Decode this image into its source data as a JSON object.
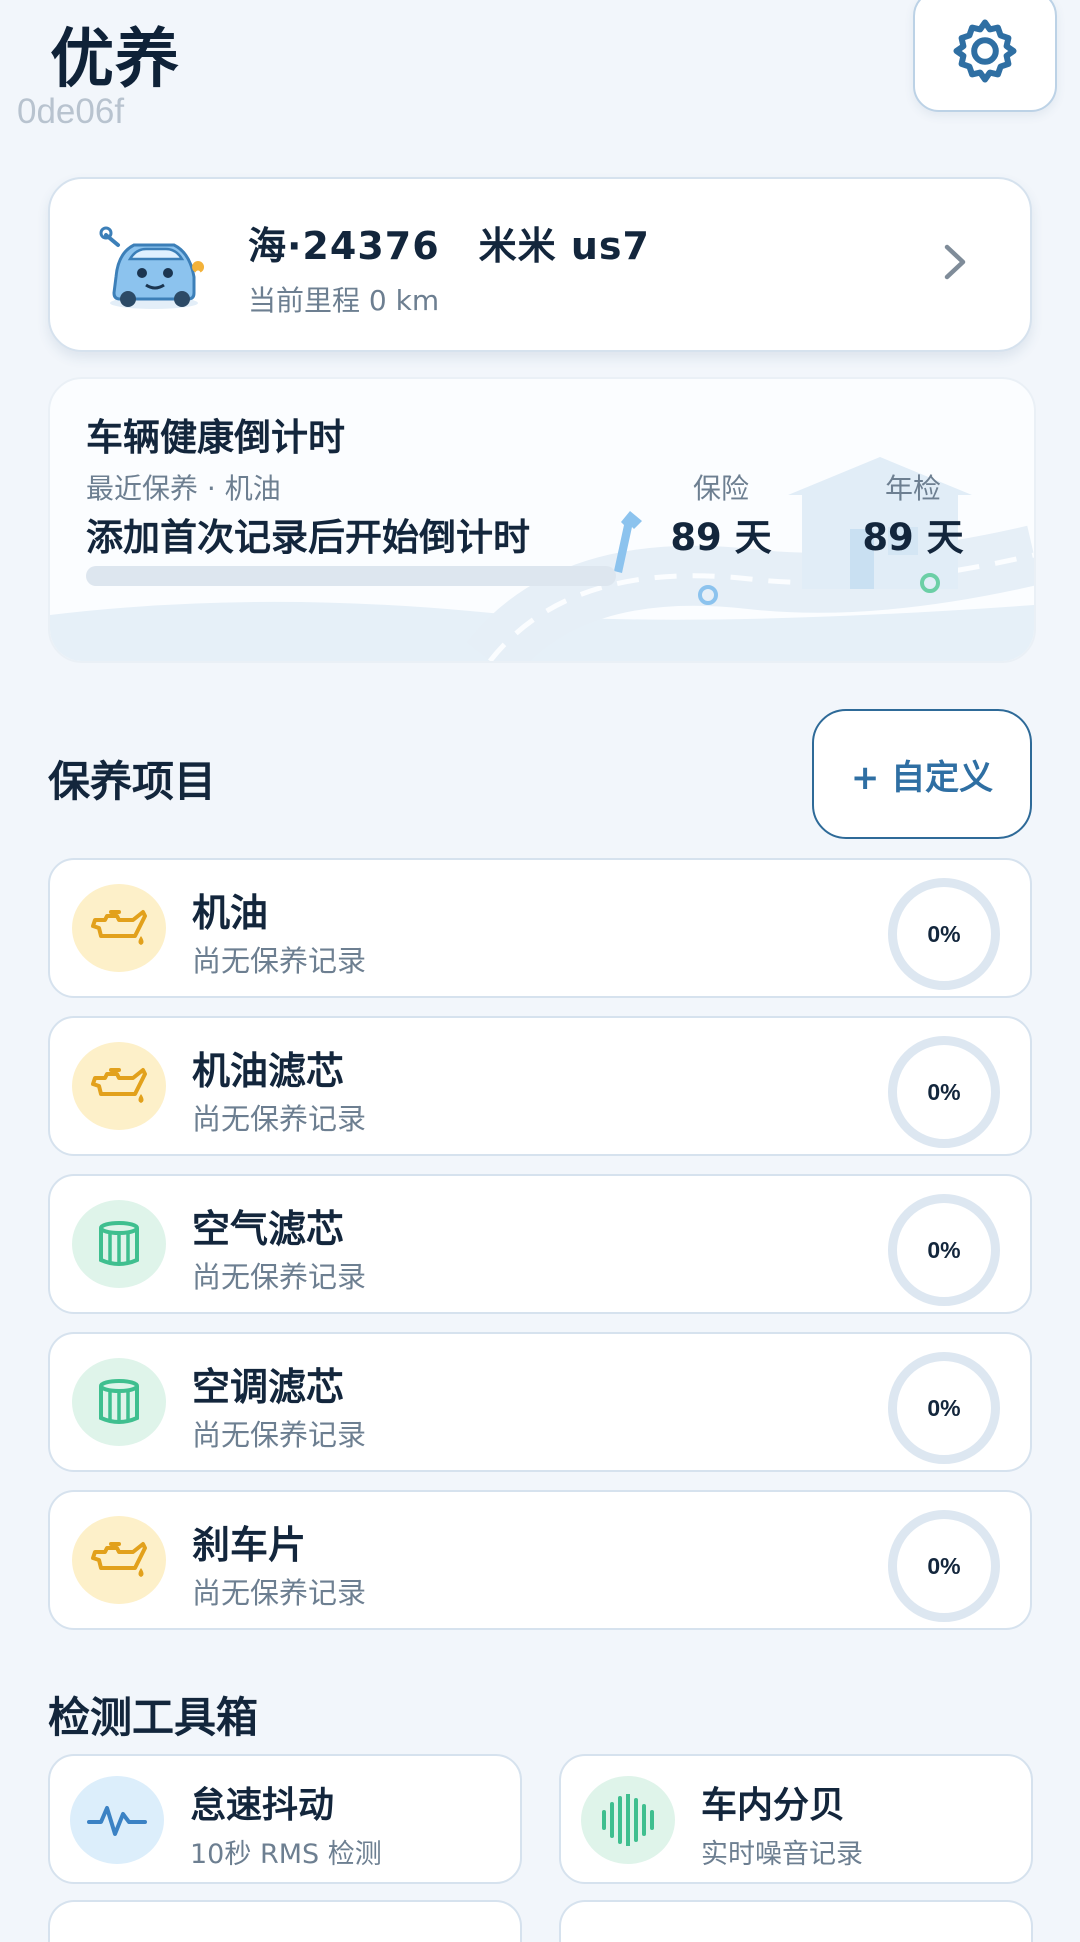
{
  "header": {
    "title": "优养",
    "debug_id": "0de06f",
    "settings_icon": "gear-icon"
  },
  "vehicle": {
    "plate_model": "海·24376　米米 us7",
    "mileage": "当前里程 0 km",
    "avatar_icon": "car-mascot-icon",
    "chevron_icon": "chevron-right-icon"
  },
  "countdown": {
    "title": "车辆健康倒计时",
    "subtitle": "最近保养 · 机油",
    "message": "添加首次记录后开始倒计时",
    "progress_fraction": 0,
    "insurance_label": "保险",
    "insurance_value": "89 天",
    "inspection_label": "年检",
    "inspection_value": "89 天"
  },
  "maintenance": {
    "title": "保养项目",
    "custom_button": "+ 自定义",
    "items": [
      {
        "name": "机油",
        "status": "尚无保养记录",
        "percent": "0%",
        "icon": "oil-can-icon",
        "color": "#e2a11c"
      },
      {
        "name": "机油滤芯",
        "status": "尚无保养记录",
        "percent": "0%",
        "icon": "oil-can-icon",
        "color": "#e2a11c"
      },
      {
        "name": "空气滤芯",
        "status": "尚无保养记录",
        "percent": "0%",
        "icon": "filter-icon",
        "color": "#3fbf8f"
      },
      {
        "name": "空调滤芯",
        "status": "尚无保养记录",
        "percent": "0%",
        "icon": "filter-icon",
        "color": "#3fbf8f"
      },
      {
        "name": "刹车片",
        "status": "尚无保养记录",
        "percent": "0%",
        "icon": "oil-can-icon",
        "color": "#e2a11c"
      }
    ]
  },
  "toolbox": {
    "title": "检测工具箱",
    "tools": [
      {
        "name": "怠速抖动",
        "desc": "10秒 RMS 检测",
        "icon": "waveform-icon",
        "color": "#3b82c4"
      },
      {
        "name": "车内分贝",
        "desc": "实时噪音记录",
        "icon": "sound-bars-icon",
        "color": "#3fbf8f"
      }
    ]
  }
}
